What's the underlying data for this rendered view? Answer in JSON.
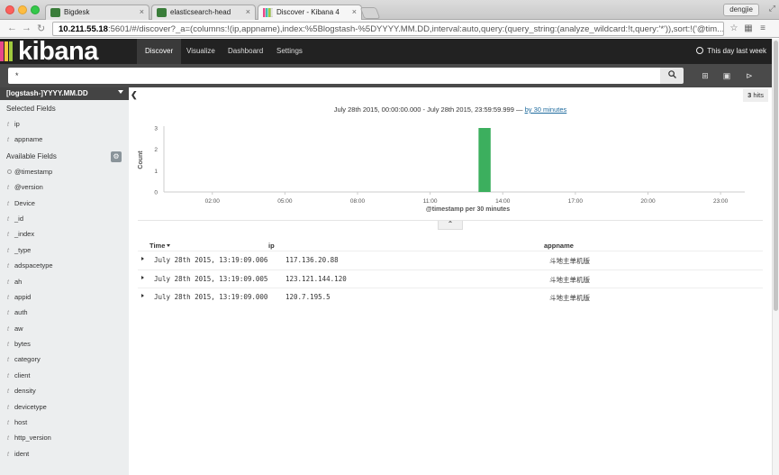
{
  "browser": {
    "tabs": [
      {
        "label": "Bigdesk",
        "active": false
      },
      {
        "label": "elasticsearch-head",
        "active": false
      },
      {
        "label": "Discover - Kibana 4",
        "active": true
      }
    ],
    "user": "dengjie",
    "url_host": "10.211.55.18",
    "url_rest": ":5601/#/discover?_a=(columns:!(ip,appname),index:%5Blogstash-%5DYYYY.MM.DD,interval:auto,query:(query_string:(analyze_wildcard:!t,query:'*')),sort:!('@tim..."
  },
  "kibana": {
    "logo": "kibana",
    "nav": [
      {
        "label": "Discover",
        "active": true
      },
      {
        "label": "Visualize",
        "active": false
      },
      {
        "label": "Dashboard",
        "active": false
      },
      {
        "label": "Settings",
        "active": false
      }
    ],
    "timepicker_label": "This day last week"
  },
  "search": {
    "query": "*"
  },
  "sidebar": {
    "index_pattern": "[logstash-]YYYY.MM.DD",
    "selected_title": "Selected Fields",
    "selected_fields": [
      {
        "type": "t",
        "name": "ip"
      },
      {
        "type": "t",
        "name": "appname"
      }
    ],
    "available_title": "Available Fields",
    "available_fields": [
      {
        "type": "clock",
        "name": "@timestamp"
      },
      {
        "type": "t",
        "name": "@version"
      },
      {
        "type": "t",
        "name": "Device"
      },
      {
        "type": "t",
        "name": "_id"
      },
      {
        "type": "t",
        "name": "_index"
      },
      {
        "type": "t",
        "name": "_type"
      },
      {
        "type": "t",
        "name": "adspacetype"
      },
      {
        "type": "t",
        "name": "ah"
      },
      {
        "type": "t",
        "name": "appid"
      },
      {
        "type": "t",
        "name": "auth"
      },
      {
        "type": "t",
        "name": "aw"
      },
      {
        "type": "t",
        "name": "bytes"
      },
      {
        "type": "t",
        "name": "category"
      },
      {
        "type": "t",
        "name": "client"
      },
      {
        "type": "t",
        "name": "density"
      },
      {
        "type": "t",
        "name": "devicetype"
      },
      {
        "type": "t",
        "name": "host"
      },
      {
        "type": "t",
        "name": "http_version"
      },
      {
        "type": "t",
        "name": "ident"
      }
    ]
  },
  "main": {
    "hits_count": "3",
    "hits_label": "hits",
    "time_range": "July 28th 2015, 00:00:00.000 - July 28th 2015, 23:59:59.999 —",
    "interval_link": "by 30 minutes",
    "columns": {
      "time": "Time",
      "ip": "ip",
      "appname": "appname"
    },
    "rows": [
      {
        "time": "July 28th 2015, 13:19:09.006",
        "ip": "117.136.20.88",
        "appname": "斗地主单机版"
      },
      {
        "time": "July 28th 2015, 13:19:09.005",
        "ip": "123.121.144.120",
        "appname": "斗地主单机版"
      },
      {
        "time": "July 28th 2015, 13:19:09.000",
        "ip": "120.7.195.5",
        "appname": "斗地主单机版"
      }
    ]
  },
  "chart_data": {
    "type": "bar",
    "xlabel": "@timestamp per 30 minutes",
    "ylabel": "Count",
    "ylim": [
      0,
      3
    ],
    "yticks": [
      "0",
      "1",
      "2",
      "3"
    ],
    "xticks": [
      "02:00",
      "05:00",
      "08:00",
      "11:00",
      "14:00",
      "17:00",
      "20:00",
      "23:00"
    ],
    "xtick_hours": [
      2,
      5,
      8,
      11,
      14,
      17,
      20,
      23
    ],
    "xrange_hours": [
      0,
      24
    ],
    "bars": [
      {
        "start_hour": 13.0,
        "end_hour": 13.5,
        "value": 3
      }
    ],
    "bar_color": "#3caf5e"
  }
}
